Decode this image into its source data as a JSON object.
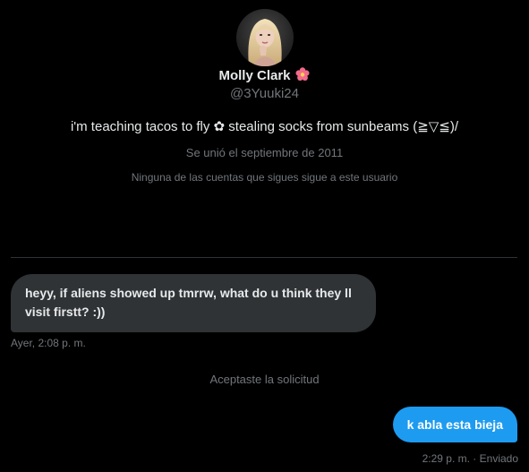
{
  "profile": {
    "avatar_alt": "Molly Clark",
    "display_name": "Molly Clark",
    "name_emoji": "flower-icon",
    "handle": "@3Yuuki24",
    "bio": "i'm teaching tacos to fly ✿ stealing socks from sunbeams (≧▽≦)/",
    "joined": "Se unió el septiembre de 2011",
    "mutuals": "Ninguna de las cuentas que sigues sigue a este usuario"
  },
  "conversation": {
    "messages": [
      {
        "direction": "incoming",
        "text": "heyy, if aliens showed up tmrrw, what do u think they ll visit firstt? :))",
        "time": "Ayer, 2:08 p. m."
      },
      {
        "direction": "system",
        "text": "Aceptaste la solicitud"
      },
      {
        "direction": "outgoing",
        "text": "k abla esta bieja",
        "time": "2:29 p. m. · Enviado"
      }
    ]
  },
  "colors": {
    "background": "#000000",
    "incoming_bubble": "#2f3336",
    "outgoing_bubble": "#1d9bf0",
    "primary_text": "#e7e9ea",
    "secondary_text": "#71767b",
    "divider": "#2f3336"
  }
}
